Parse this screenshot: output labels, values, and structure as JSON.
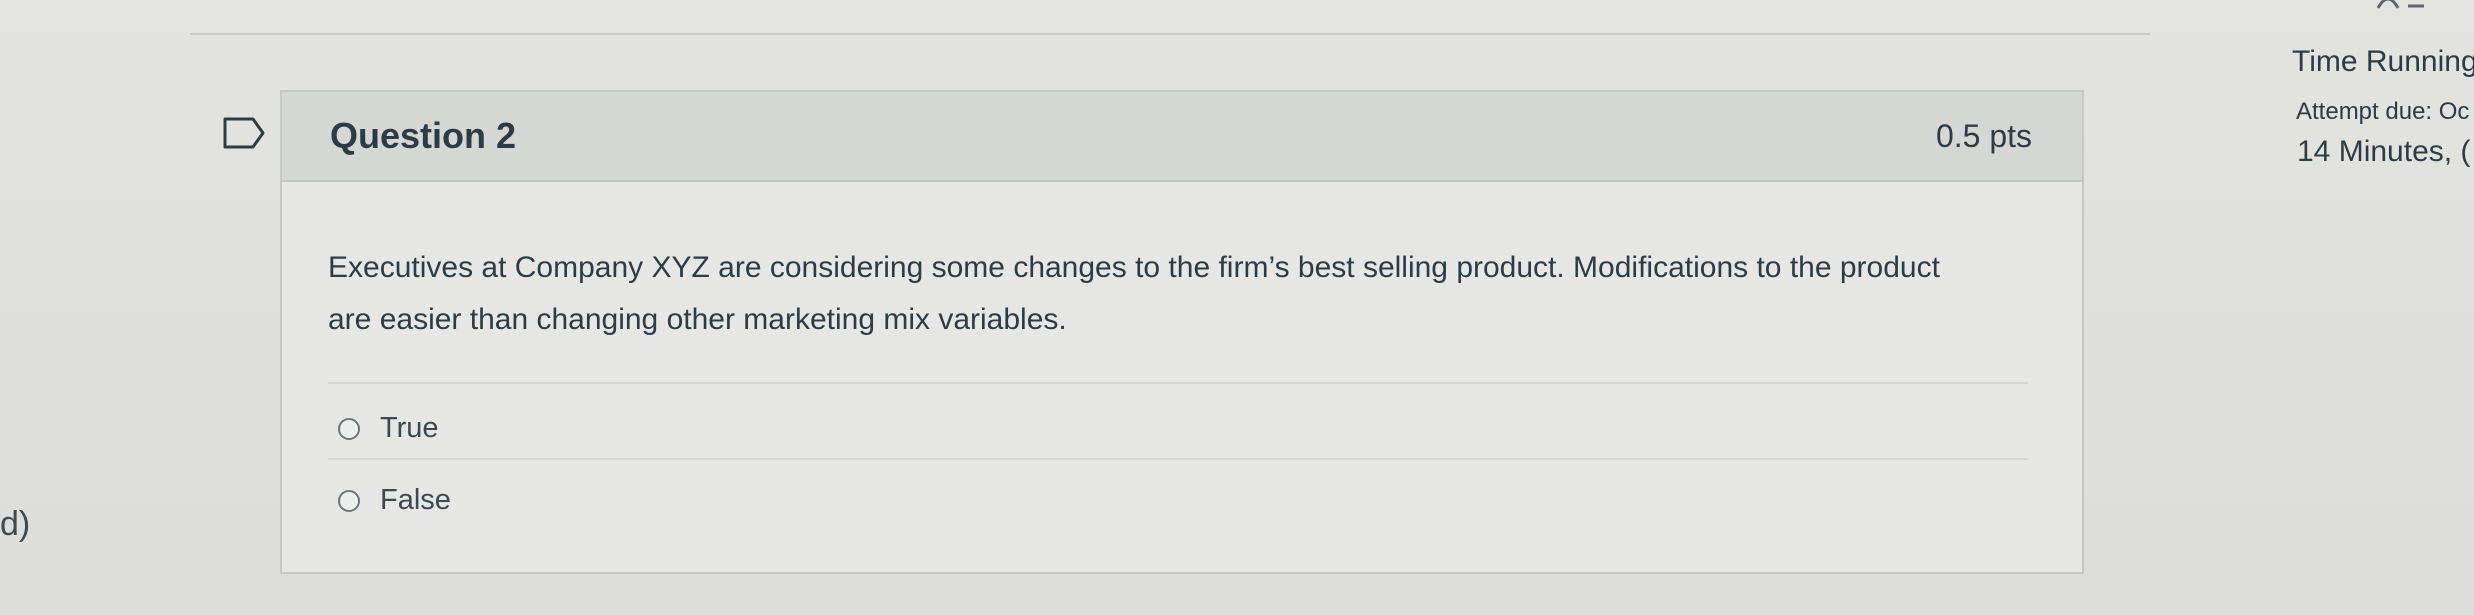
{
  "question": {
    "title": "Question 2",
    "points": "0.5 pts",
    "text": "Executives at Company XYZ are considering some changes to the firm’s best selling product. Modifications to the product are easier than changing other marketing mix variables.",
    "answers": [
      {
        "label": "True",
        "selected": false
      },
      {
        "label": "False",
        "selected": false
      }
    ]
  },
  "sidebar": {
    "timer_status": "Time Running",
    "attempt_due": "Attempt due: Oc",
    "time_remaining": "14 Minutes, ("
  },
  "left_edge_text": "d)",
  "colors": {
    "background": "#dedfdb",
    "card": "#e6e7e4",
    "card_header": "#d5d7d4",
    "text": "#2d3b45"
  }
}
